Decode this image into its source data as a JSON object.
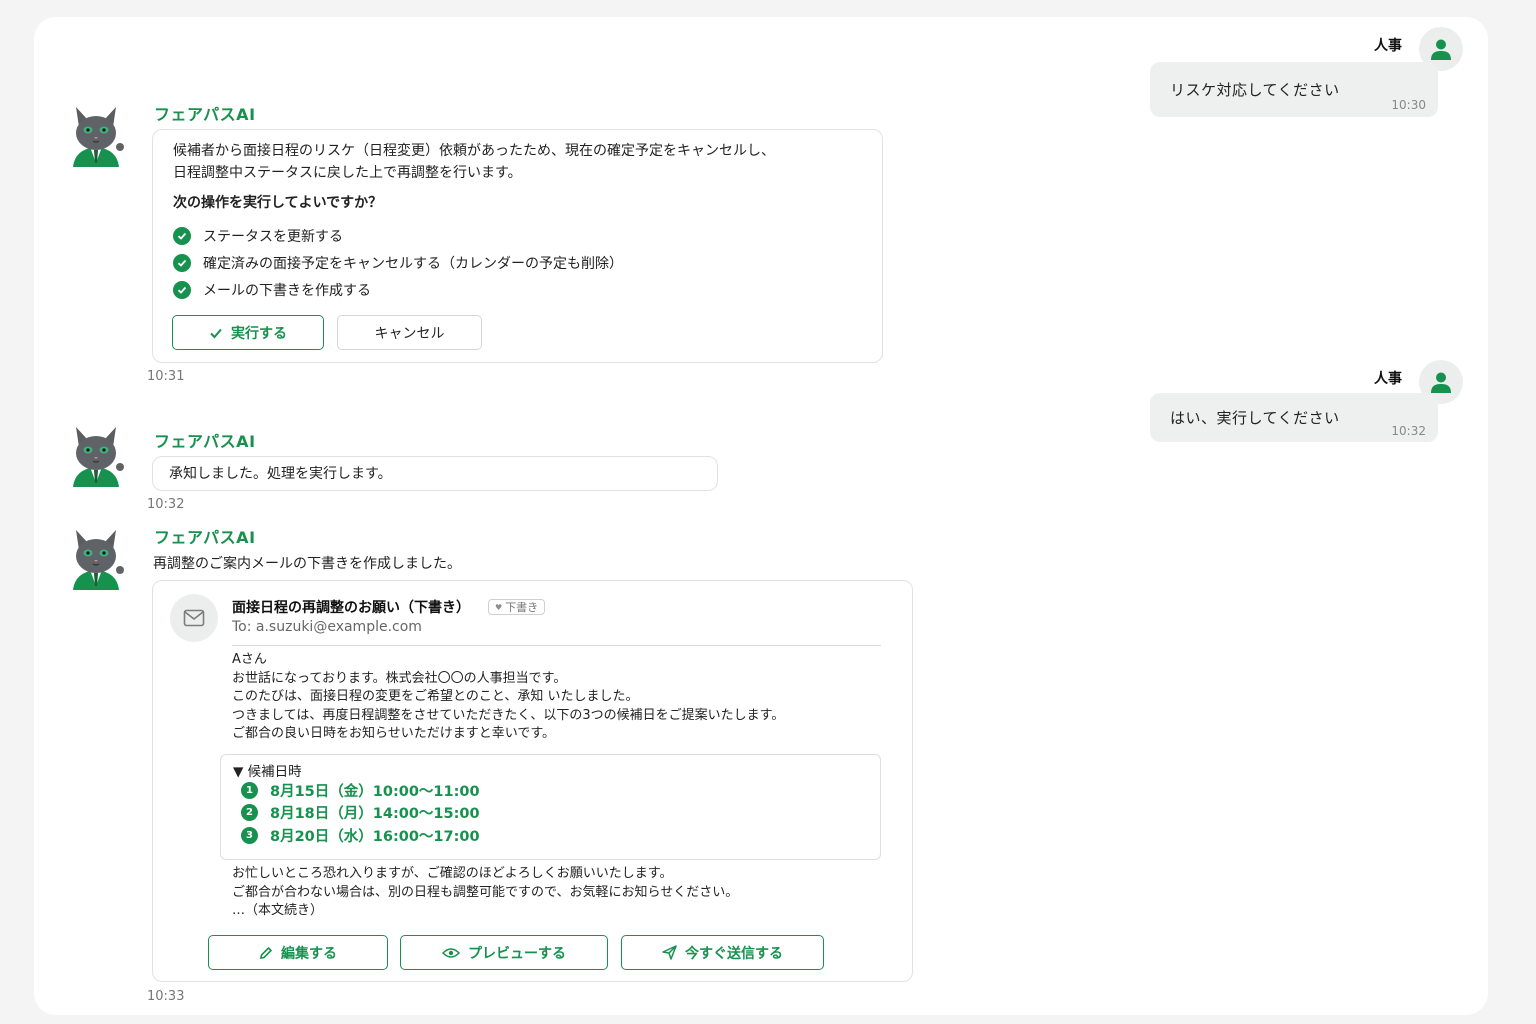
{
  "user": {
    "name": "人事",
    "messages": [
      {
        "text": "リスケ対応してください",
        "time": "10:30"
      },
      {
        "text": "はい、実行してください",
        "time": "10:32"
      }
    ]
  },
  "ai": {
    "name": "フェアパスAI",
    "msg1": {
      "line1": "候補者から面接日程のリスケ（日程変更）依頼があったため、現在の確定予定をキャンセルし、",
      "line2": "日程調整中ステータスに戻した上で再調整を行います。",
      "question": "次の操作を実行してよいですか？",
      "actions": [
        "ステータスを更新する",
        "確定済みの面接予定をキャンセルする（カレンダーの予定も削除）",
        "メールの下書きを作成する"
      ],
      "execute_label": "実行する",
      "cancel_label": "キャンセル",
      "time": "10:31"
    },
    "msg2": {
      "text": "承知しました。処理を実行します。",
      "time": "10:32"
    },
    "msg3": {
      "intro": "再調整のご案内メールの下書きを作成しました。",
      "email": {
        "subject": "面接日程の再調整のお願い（下書き）",
        "badge": "下書き",
        "to": "To: a.suzuki@example.com",
        "body": [
          "Aさん",
          "お世話になっております。株式会社〇〇の人事担当です。",
          "このたびは、面接日程の変更をご希望とのこと、承知 いたしました。",
          "つきましては、再度日程調整をさせていただきたく、以下の3つの候補日をご提案いたします。",
          "ご都合の良い日時をお知らせいただけますと幸いです。"
        ],
        "candidates_title": "▼ 候補日時",
        "candidates": [
          {
            "num": "1",
            "date": "8月15日（金）",
            "time": "10:00〜11:00"
          },
          {
            "num": "2",
            "date": "8月18日（月）",
            "time": "14:00〜15:00"
          },
          {
            "num": "3",
            "date": "8月20日（水）",
            "time": "16:00〜17:00"
          }
        ],
        "closing": [
          "お忙しいところ恐れ入りますが、ご確認のほどよろしくお願いいたします。",
          "ご都合が合わない場合は、別の日程も調整可能ですので、お気軽にお知らせください。",
          "…（本文続き）"
        ],
        "edit_label": "編集する",
        "preview_label": "プレビューする",
        "send_label": "今すぐ送信する"
      },
      "time": "10:33"
    }
  },
  "colors": {
    "accent": "#17924e",
    "bubble": "#eef0ef",
    "background": "#f3f4f3"
  }
}
